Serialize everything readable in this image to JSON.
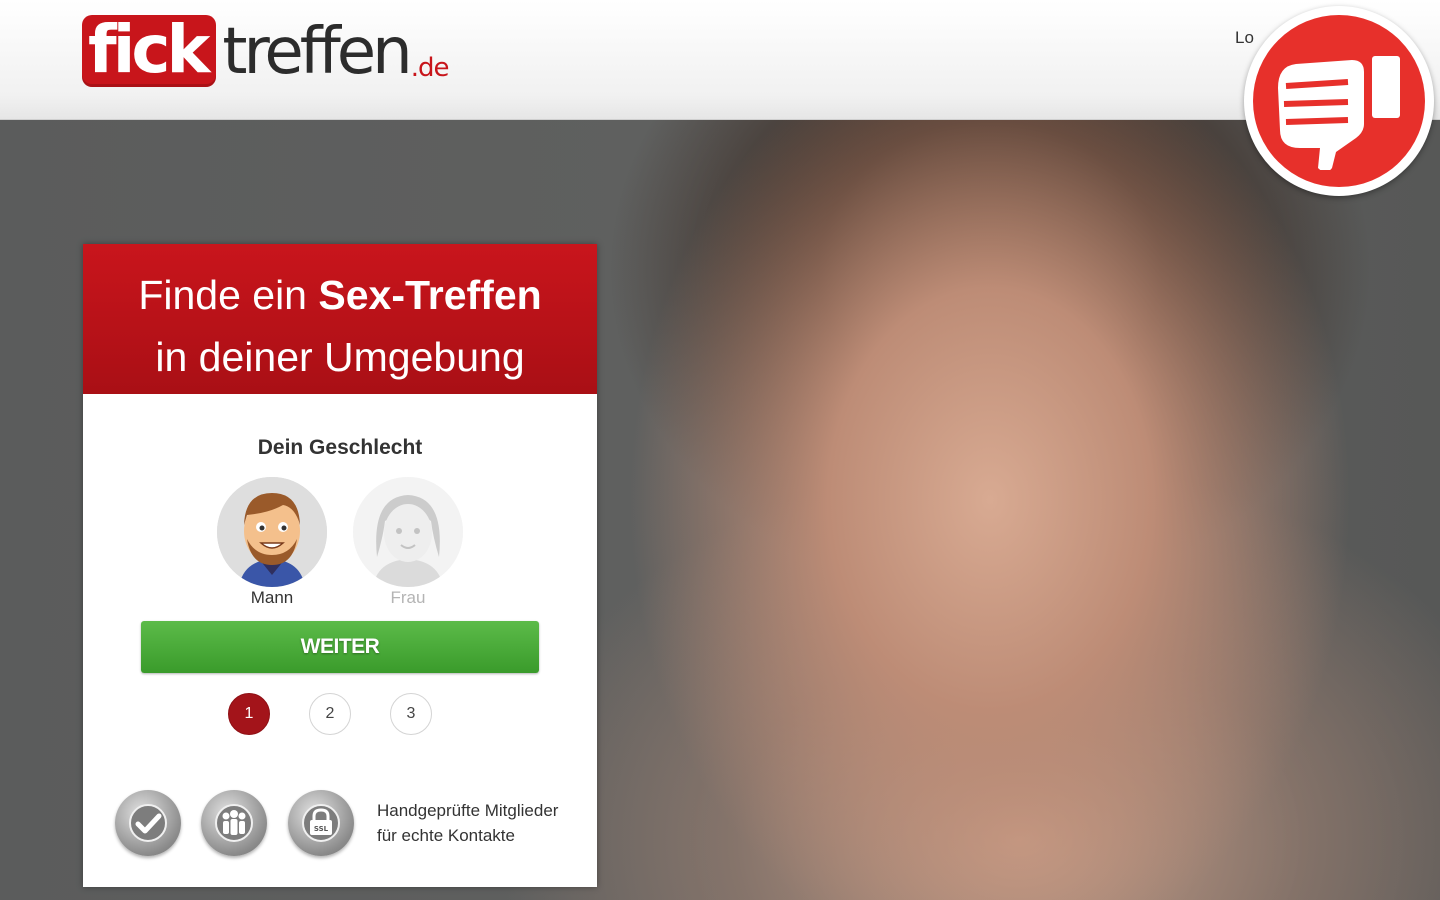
{
  "header": {
    "logo": {
      "part1": "fick",
      "part2": "treffen",
      "tld": ".de"
    },
    "login_label": "Lo"
  },
  "badge": {
    "icon": "thumbs-down-icon",
    "color": "#e7302b"
  },
  "signup": {
    "headline_line1_prefix": "Finde ein ",
    "headline_line1_bold": "Sex-Treffen",
    "headline_line2": "in deiner Umgebung",
    "gender_title": "Dein Geschlecht",
    "gender_options": [
      {
        "label": "Mann",
        "selected": true
      },
      {
        "label": "Frau",
        "selected": false
      }
    ],
    "continue_label": "WEITER",
    "steps": [
      "1",
      "2",
      "3"
    ],
    "current_step": "1",
    "trust_icons": [
      "verified-check-icon",
      "members-group-icon",
      "ssl-lock-icon"
    ],
    "trust_line1": "Handgeprüfte Mitglieder",
    "trust_line2": "für echte Kontakte"
  },
  "colors": {
    "brand_red": "#c8151b",
    "button_green": "#4aab38",
    "step_active": "#a3141a"
  }
}
